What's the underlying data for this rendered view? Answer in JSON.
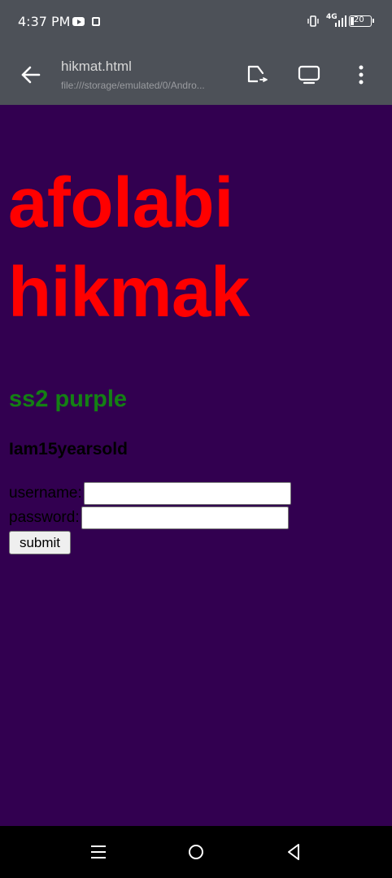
{
  "status_bar": {
    "time": "4:37 PM",
    "network": "4G",
    "battery": "20",
    "icons": [
      "youtube-icon",
      "message-icon",
      "vibrate-icon",
      "signal-icon",
      "battery-icon"
    ]
  },
  "toolbar": {
    "title": "hikmat.html",
    "url": "file:///storage/emulated/0/Andro...",
    "icons": [
      "back-arrow-icon",
      "share-icon",
      "desktop-icon",
      "more-vert-icon"
    ]
  },
  "page": {
    "heading_line1": "afolabi",
    "heading_line2": "hikmak",
    "subheading": "ss2 purple",
    "age_text": "Iam15yearsold",
    "username_label": "username:",
    "username_value": "",
    "password_label": "password:",
    "password_value": "",
    "submit_label": "submit"
  },
  "nav_bar": {
    "icons": [
      "menu-icon",
      "home-icon",
      "back-icon"
    ]
  },
  "colors": {
    "page_background": "#320050",
    "heading": "#ff0000",
    "subheading": "#148014",
    "chrome": "#4d5158"
  }
}
